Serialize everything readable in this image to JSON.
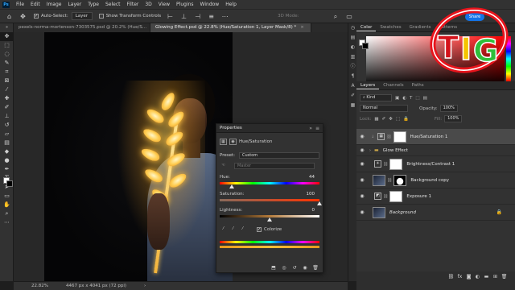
{
  "app": {
    "logo_text": "Ps"
  },
  "menu": [
    "File",
    "Edit",
    "Image",
    "Layer",
    "Type",
    "Select",
    "Filter",
    "3D",
    "View",
    "Plugins",
    "Window",
    "Help"
  ],
  "options_bar": {
    "auto_select_label": "Auto-Select:",
    "auto_select_value": "Layer",
    "show_transform_label": "Show Transform Controls",
    "mode_3d_label": "3D Mode:",
    "share_label": "Share"
  },
  "doc_tabs": [
    {
      "label": "pexels-norma-mortenson-7303575.psd @ 20.2% (Hue/S...",
      "active": false
    },
    {
      "label": "Glowing Effect.psd @ 22.8% (Hue/Saturation 1, Layer Mask/8) *",
      "active": true
    }
  ],
  "properties": {
    "title": "Properties",
    "panel_type": "Hue/Saturation",
    "preset_label": "Preset:",
    "preset_value": "Custom",
    "channel_value": "Master",
    "hue_label": "Hue:",
    "hue_value": "44",
    "saturation_label": "Saturation:",
    "saturation_value": "100",
    "lightness_label": "Lightness:",
    "lightness_value": "0",
    "colorize_label": "Colorize",
    "colorize_checked": true,
    "hue_fraction": 0.122,
    "saturation_fraction": 1.0,
    "lightness_fraction": 0.5
  },
  "color_panel": {
    "tabs": [
      "Color",
      "Swatches",
      "Gradients",
      "Patterns"
    ],
    "foreground": "#ffffff",
    "background": "#000000"
  },
  "layers_panel": {
    "tabs": [
      "Layers",
      "Channels",
      "Paths"
    ],
    "kind_label": "Kind",
    "blend_mode": "Normal",
    "opacity_label": "Opacity:",
    "opacity_value": "100%",
    "lock_label": "Lock:",
    "fill_label": "Fill:",
    "fill_value": "100%",
    "layers": [
      {
        "name": "Hue/Saturation 1",
        "type": "adjustment",
        "selected": true
      },
      {
        "name": "Glow Effect",
        "type": "group",
        "selected": false
      },
      {
        "name": "Brightness/Contrast 1",
        "type": "adjustment",
        "selected": false
      },
      {
        "name": "Background copy",
        "type": "pixel",
        "selected": false
      },
      {
        "name": "Exposure 1",
        "type": "adjustment",
        "selected": false
      },
      {
        "name": "Background",
        "type": "background",
        "selected": false
      }
    ]
  },
  "status": {
    "zoom": "22.82%",
    "doc_size": "4467 px x 4041 px (72 ppi)"
  },
  "accent_colors": {
    "share_button": "#1473e6",
    "glow": "#ffbf3a"
  }
}
